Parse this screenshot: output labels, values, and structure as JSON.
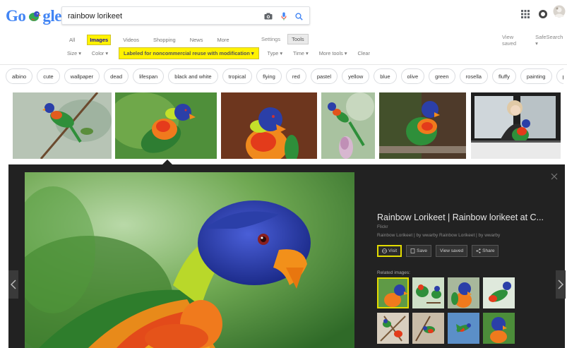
{
  "search": {
    "query": "rainbow lorikeet"
  },
  "logo": {
    "text_g": "Go",
    "text_gle": "gle"
  },
  "tabs": {
    "items": [
      "All",
      "Images",
      "Videos",
      "Shopping",
      "News",
      "More"
    ],
    "active": "Images",
    "settings": "Settings",
    "tools": "Tools"
  },
  "right_links": {
    "view_saved": "View saved",
    "safesearch": "SafeSearch ▾"
  },
  "filters": {
    "size": "Size ▾",
    "color": "Color ▾",
    "license": "Labeled for noncommercial reuse with modification ▾",
    "type": "Type ▾",
    "time": "Time ▾",
    "more_tools": "More tools ▾",
    "clear": "Clear"
  },
  "chips": [
    "albino",
    "cute",
    "wallpaper",
    "dead",
    "lifespan",
    "black and white",
    "tropical",
    "flying",
    "red",
    "pastel",
    "yellow",
    "blue",
    "olive",
    "green",
    "rosella",
    "fluffy",
    "painting",
    "pet"
  ],
  "preview": {
    "title": "Rainbow Lorikeet | Rainbow lorikeet at C...",
    "source": "Flickr",
    "caption": "Rainbow Lorikeet | by wwarby Rainbow Lorikeet | by wwarby",
    "actions": {
      "visit": "Visit",
      "save": "Save",
      "view_saved": "View saved",
      "share": "Share"
    },
    "related_label": "Related images:"
  },
  "colors": {
    "highlight": "#fff200",
    "panel_bg": "#222222",
    "link_blue": "#1a0dab"
  }
}
